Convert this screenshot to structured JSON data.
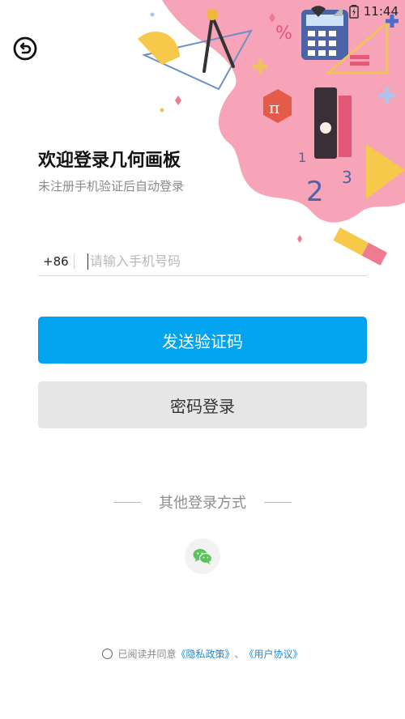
{
  "status_bar": {
    "time": "11:44"
  },
  "header": {
    "title": "欢迎登录几何画板",
    "subtitle": "未注册手机验证后自动登录"
  },
  "phone": {
    "country_code": "+86",
    "placeholder": "请输入手机号码",
    "value": ""
  },
  "buttons": {
    "send_code": "发送验证码",
    "password_login": "密码登录"
  },
  "other_login": {
    "label": "其他登录方式",
    "methods": [
      "wechat-icon"
    ]
  },
  "agreement": {
    "prefix": "已阅读并同意",
    "privacy": "《隐私政策》",
    "separator": "、",
    "user_agreement": "《用户协议》",
    "checked": false
  },
  "colors": {
    "primary": "#03a4ef",
    "secondary_button": "#e6e6e6",
    "illustration_pink": "#f7a3b8",
    "wechat": "#5ac55a",
    "link": "#1f8ad3"
  }
}
